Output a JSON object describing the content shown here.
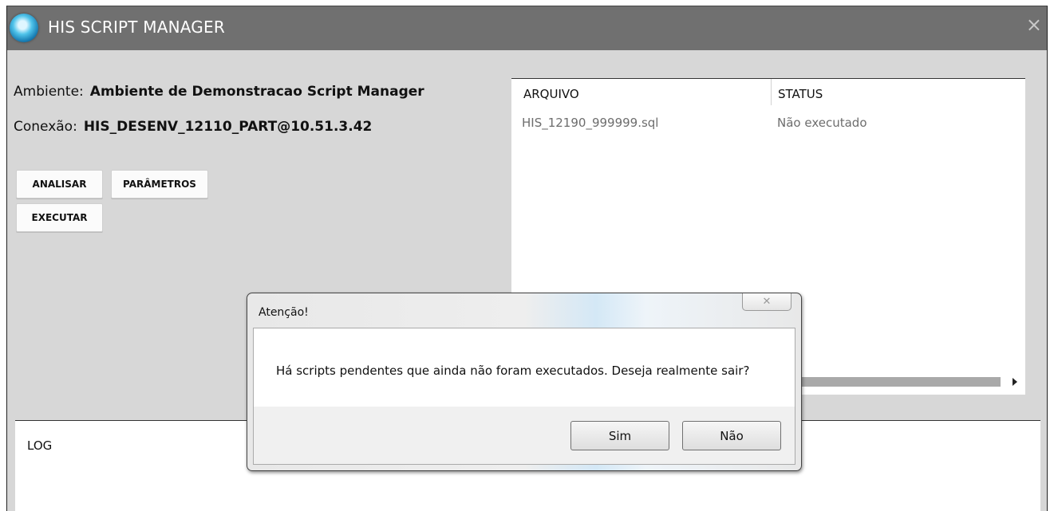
{
  "window": {
    "title": "HIS SCRIPT MANAGER",
    "close_glyph": "×"
  },
  "info": {
    "ambiente_label": "Ambiente:",
    "ambiente_value": "Ambiente de Demonstracao Script Manager",
    "conexao_label": "Conexão:",
    "conexao_value": "HIS_DESENV_12110_PART@10.51.3.42"
  },
  "buttons": {
    "analisar": "ANALISAR",
    "parametros": "PARÂMETROS",
    "executar": "EXECUTAR"
  },
  "grid": {
    "columns": [
      "ARQUIVO",
      "STATUS"
    ],
    "rows": [
      {
        "arquivo": "HIS_12190_999999.sql",
        "status": "Não executado"
      }
    ]
  },
  "log": {
    "title": "LOG"
  },
  "dialog": {
    "title": "Atenção!",
    "close_glyph": "✕",
    "message": "Há scripts pendentes que ainda não foram executados. Deseja realmente sair?",
    "yes_label": "Sim",
    "no_label": "Não"
  },
  "icons": {
    "app_logo": "app-logo-icon",
    "window_close": "close-icon",
    "scroll_right": "arrow-right-icon"
  },
  "colors": {
    "titlebar": "#707070",
    "window_bg": "#d7d7d7",
    "panel_bg": "#ffffff"
  }
}
